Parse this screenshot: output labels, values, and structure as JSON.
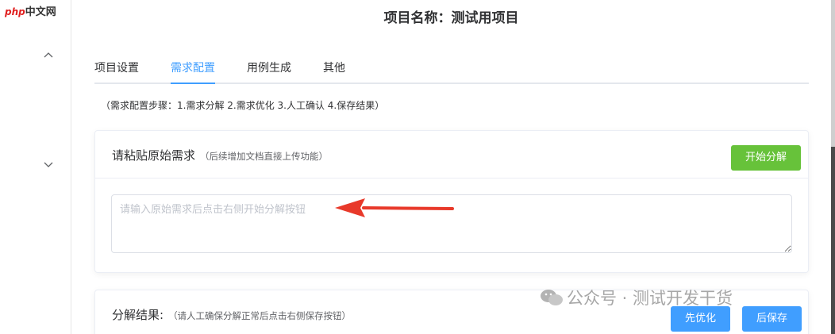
{
  "logo": {
    "php": "php",
    "cn": "中文网"
  },
  "sidebar": {
    "icons": [
      "chevron-up-icon",
      "chevron-down-icon"
    ]
  },
  "page_title": "项目名称：测试用项目",
  "tabs": [
    {
      "label": "项目设置",
      "active": false
    },
    {
      "label": "需求配置",
      "active": true
    },
    {
      "label": "用例生成",
      "active": false
    },
    {
      "label": "其他",
      "active": false
    }
  ],
  "steps_text": "（需求配置步骤：1.需求分解 2.需求优化 3.人工确认 4.保存结果）",
  "requirement_card": {
    "title": "请粘贴原始需求",
    "hint": "（后续增加文档直接上传功能）",
    "start_button": "开始分解",
    "textarea_placeholder": "请输入原始需求后点击右侧开始分解按钮",
    "textarea_value": ""
  },
  "result_card": {
    "title": "分解结果:",
    "hint": "（请人工确保分解正常后点击右侧保存按钮）",
    "optimize_button": "先优化",
    "save_button": "后保存"
  },
  "watermark": "公众号 · 测试开发干货",
  "colors": {
    "primary": "#409eff",
    "success": "#67c23a",
    "annotation_arrow": "#e8392a"
  }
}
